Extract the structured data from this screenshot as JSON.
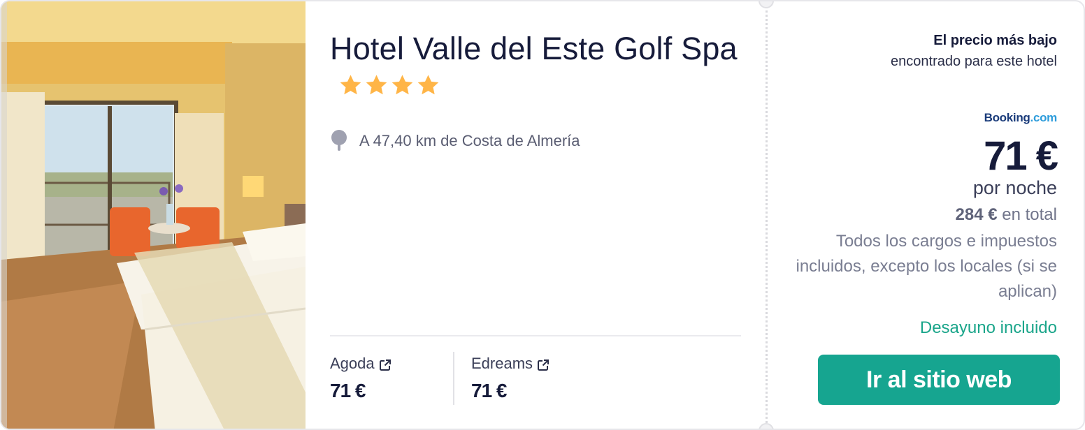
{
  "hotel": {
    "name": "Hotel Valle del Este Golf Spa",
    "stars": 4,
    "location": "A 47,40 km de Costa de Almería"
  },
  "providers": [
    {
      "name": "Agoda",
      "price": "71 €"
    },
    {
      "name": "Edreams",
      "price": "71 €"
    }
  ],
  "deal": {
    "lowest_title": "El precio más bajo",
    "lowest_sub": "encontrado para este hotel",
    "logo_main": "Booking",
    "logo_suffix": ".com",
    "price": "71 €",
    "per_night": "por noche",
    "total_amount": "284 €",
    "total_label": " en total",
    "taxes_note": "Todos los cargos e impuestos incluidos, excepto los locales (si se aplican)",
    "breakfast": "Desayuno incluido",
    "cta_label": "Ir al sitio web"
  },
  "colors": {
    "accent": "#16a590",
    "breakfast": "#1aa58a",
    "star": "#ffb547",
    "text_primary": "#161b3a"
  },
  "icons": [
    "map-pin-icon",
    "star-icon",
    "external-link-icon"
  ]
}
